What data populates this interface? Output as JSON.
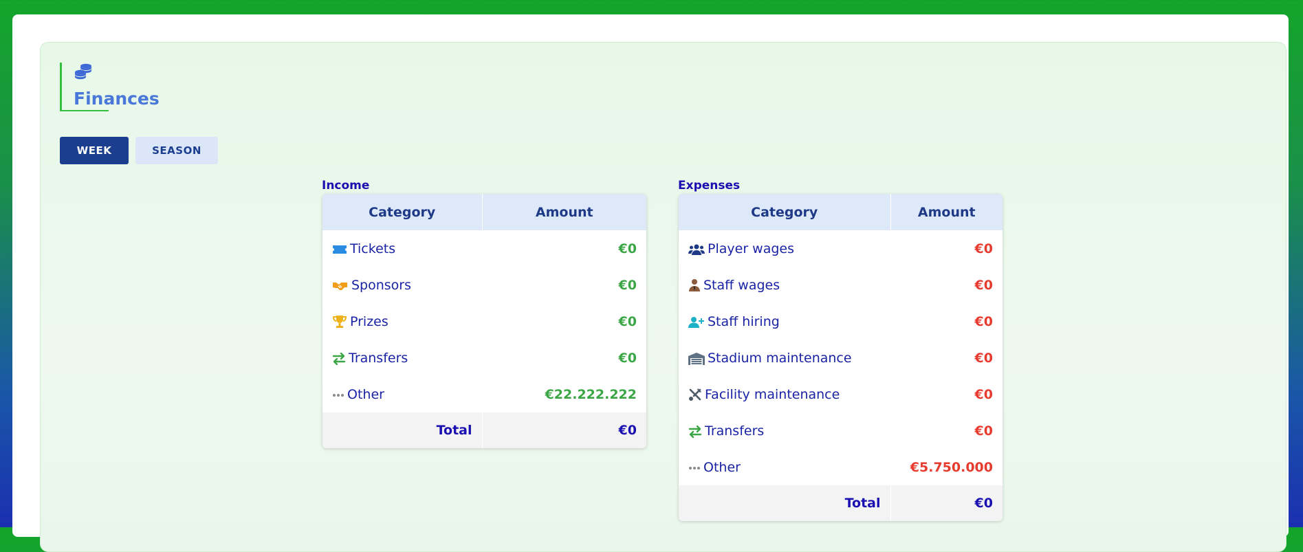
{
  "page": {
    "title": "Finances",
    "tabs": [
      {
        "label": "WEEK",
        "active": true
      },
      {
        "label": "SEASON",
        "active": false
      }
    ]
  },
  "income": {
    "label": "Income",
    "headers": {
      "category": "Category",
      "amount": "Amount"
    },
    "rows": [
      {
        "icon": "ticket-icon",
        "category": "Tickets",
        "amount": "€0"
      },
      {
        "icon": "handshake-icon",
        "category": "Sponsors",
        "amount": "€0"
      },
      {
        "icon": "trophy-icon",
        "category": "Prizes",
        "amount": "€0"
      },
      {
        "icon": "transfer-arrows-icon",
        "category": "Transfers",
        "amount": "€0"
      },
      {
        "icon": "ellipsis-icon",
        "category": "Other",
        "amount": "€22.222.222"
      }
    ],
    "total": {
      "label": "Total",
      "amount": "€0"
    }
  },
  "expenses": {
    "label": "Expenses",
    "headers": {
      "category": "Category",
      "amount": "Amount"
    },
    "rows": [
      {
        "icon": "users-icon",
        "category": "Player wages",
        "amount": "€0"
      },
      {
        "icon": "user-tie-icon",
        "category": "Staff wages",
        "amount": "€0"
      },
      {
        "icon": "user-plus-icon",
        "category": "Staff hiring",
        "amount": "€0"
      },
      {
        "icon": "warehouse-icon",
        "category": "Stadium maintenance",
        "amount": "€0"
      },
      {
        "icon": "tools-icon",
        "category": "Facility maintenance",
        "amount": "€0"
      },
      {
        "icon": "transfer-arrows-icon",
        "category": "Transfers",
        "amount": "€0"
      },
      {
        "icon": "ellipsis-icon",
        "category": "Other",
        "amount": "€5.750.000"
      }
    ],
    "total": {
      "label": "Total",
      "amount": "€0"
    }
  },
  "colors": {
    "income_amount": "#3ba645",
    "expense_amount": "#e83b2f",
    "active_tab": "#1b3e8f",
    "title": "#4a78d8"
  }
}
